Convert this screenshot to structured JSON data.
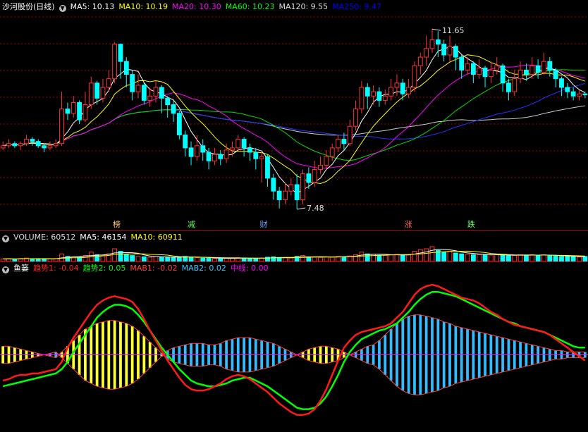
{
  "main_header": {
    "stock_name": "沙河股份(日线)",
    "items": [
      {
        "label": "MA5: 10.13",
        "color": "#ffffff"
      },
      {
        "label": "MA10: 10.19",
        "color": "#ffff00"
      },
      {
        "label": "MA20: 10.30",
        "color": "#ff00ff"
      },
      {
        "label": "MA60: 10.23",
        "color": "#00ff00"
      },
      {
        "label": "MA120: 9.55",
        "color": "#dddddd"
      },
      {
        "label": "MA250: 9.47",
        "color": "#0000ff"
      }
    ]
  },
  "price_high_label": "11.65",
  "price_low_label": "7.48",
  "event_markers": [
    {
      "text": "榜",
      "color": "#ffcc66",
      "pos": 0.199
    },
    {
      "text": "减",
      "color": "#66ff66",
      "pos": 0.326
    },
    {
      "text": "财",
      "color": "#66aaff",
      "pos": 0.449
    },
    {
      "text": "涨",
      "color": "#ff6666",
      "pos": 0.695
    },
    {
      "text": "跌",
      "color": "#66ff66",
      "pos": 0.802
    }
  ],
  "volume_header": {
    "items": [
      {
        "label": "VOLUME: 60512",
        "color": "#dddddd"
      },
      {
        "label": "MA5: 46154",
        "color": "#ffffff"
      },
      {
        "label": "MA10: 60911",
        "color": "#ffff00"
      }
    ]
  },
  "indicator_header": {
    "name": "鱼篓",
    "items": [
      {
        "label": "趋势1: -0.04",
        "color": "#ff2020"
      },
      {
        "label": "趋势2: 0.05",
        "color": "#00ff00"
      },
      {
        "label": "MAB1: -0.02",
        "color": "#ff4040"
      },
      {
        "label": "MAB2: 0.02",
        "color": "#33ccff"
      },
      {
        "label": "中线: 0.00",
        "color": "#ff00ff"
      }
    ]
  },
  "colors": {
    "up": "#ff3333",
    "down": "#00ffff",
    "grid": "#a00000",
    "yellow_bar": "#ffff33",
    "blue_bar": "#33bbff"
  },
  "chart_data": {
    "type": "candlestick",
    "price_range": [
      7.3,
      11.8
    ],
    "candles": [
      [
        8.9,
        8.95,
        9.05,
        8.85
      ],
      [
        8.95,
        9.0,
        9.1,
        8.9
      ],
      [
        9.0,
        8.95,
        9.05,
        8.9
      ],
      [
        8.95,
        9.0,
        9.05,
        8.85
      ],
      [
        9.0,
        9.1,
        9.2,
        8.95
      ],
      [
        9.1,
        9.05,
        9.15,
        8.95
      ],
      [
        9.05,
        8.95,
        9.1,
        8.9
      ],
      [
        8.95,
        8.9,
        9.0,
        8.8
      ],
      [
        8.9,
        8.95,
        9.05,
        8.85
      ],
      [
        8.95,
        9.0,
        9.1,
        8.9
      ],
      [
        9.0,
        9.8,
        10.2,
        8.95
      ],
      [
        9.8,
        9.7,
        9.95,
        9.55
      ],
      [
        9.7,
        9.95,
        10.1,
        9.6
      ],
      [
        9.95,
        9.55,
        10.0,
        9.45
      ],
      [
        9.55,
        9.9,
        10.2,
        9.5
      ],
      [
        9.9,
        10.4,
        10.55,
        9.8
      ],
      [
        10.4,
        10.05,
        10.45,
        9.9
      ],
      [
        10.05,
        10.3,
        10.5,
        9.95
      ],
      [
        10.3,
        10.5,
        10.7,
        10.2
      ],
      [
        10.5,
        11.3,
        11.35,
        10.4
      ],
      [
        11.3,
        10.9,
        11.3,
        10.5
      ],
      [
        10.9,
        10.6,
        11.0,
        10.3
      ],
      [
        10.6,
        10.2,
        10.7,
        10.0
      ],
      [
        10.2,
        10.35,
        10.6,
        10.05
      ],
      [
        10.35,
        10.0,
        10.4,
        9.9
      ],
      [
        10.0,
        10.1,
        10.3,
        9.85
      ],
      [
        10.1,
        10.3,
        10.45,
        9.95
      ],
      [
        10.3,
        10.05,
        10.35,
        9.7
      ],
      [
        10.05,
        9.9,
        10.1,
        9.6
      ],
      [
        9.9,
        9.7,
        10.0,
        9.5
      ],
      [
        9.7,
        9.2,
        9.75,
        9.1
      ],
      [
        9.2,
        8.9,
        9.3,
        8.7
      ],
      [
        8.9,
        8.7,
        9.05,
        8.5
      ],
      [
        8.7,
        8.95,
        9.2,
        8.6
      ],
      [
        8.95,
        8.8,
        9.1,
        8.6
      ],
      [
        8.8,
        8.6,
        8.9,
        8.4
      ],
      [
        8.6,
        8.75,
        8.9,
        8.5
      ],
      [
        8.75,
        8.65,
        8.85,
        8.5
      ],
      [
        8.65,
        8.85,
        9.0,
        8.55
      ],
      [
        8.85,
        8.9,
        9.05,
        8.7
      ],
      [
        8.9,
        9.1,
        9.2,
        8.8
      ],
      [
        9.1,
        8.9,
        9.15,
        8.7
      ],
      [
        8.9,
        8.8,
        9.0,
        8.6
      ],
      [
        8.8,
        8.65,
        8.9,
        8.4
      ],
      [
        8.65,
        8.7,
        8.8,
        8.1
      ],
      [
        8.7,
        8.2,
        8.75,
        8.0
      ],
      [
        8.2,
        7.9,
        8.3,
        7.7
      ],
      [
        7.9,
        7.7,
        8.0,
        7.5
      ],
      [
        7.7,
        7.9,
        8.1,
        7.6
      ],
      [
        7.9,
        8.05,
        8.2,
        7.8
      ],
      [
        8.05,
        7.7,
        8.3,
        7.48
      ],
      [
        7.7,
        8.3,
        8.4,
        7.6
      ],
      [
        8.3,
        8.1,
        8.45,
        7.95
      ],
      [
        8.1,
        8.4,
        8.6,
        8.0
      ],
      [
        8.4,
        8.5,
        8.7,
        8.3
      ],
      [
        8.5,
        8.7,
        8.85,
        8.4
      ],
      [
        8.7,
        8.9,
        9.0,
        8.6
      ],
      [
        8.9,
        9.1,
        9.2,
        8.8
      ],
      [
        9.1,
        9.0,
        9.25,
        8.85
      ],
      [
        9.0,
        9.4,
        9.55,
        8.95
      ],
      [
        9.4,
        9.8,
        10.0,
        9.3
      ],
      [
        9.8,
        10.3,
        10.45,
        9.7
      ],
      [
        10.3,
        10.1,
        10.4,
        9.8
      ],
      [
        10.1,
        10.2,
        10.35,
        9.9
      ],
      [
        10.2,
        10.0,
        10.3,
        9.85
      ],
      [
        10.0,
        10.1,
        10.25,
        9.9
      ],
      [
        10.1,
        10.3,
        10.5,
        10.0
      ],
      [
        10.3,
        10.4,
        10.6,
        10.1
      ],
      [
        10.4,
        10.15,
        10.5,
        10.0
      ],
      [
        10.15,
        10.3,
        10.5,
        10.05
      ],
      [
        10.3,
        10.8,
        10.9,
        10.2
      ],
      [
        10.8,
        11.0,
        11.1,
        10.6
      ],
      [
        11.0,
        11.2,
        11.5,
        10.8
      ],
      [
        11.2,
        11.4,
        11.65,
        11.1
      ],
      [
        11.4,
        11.3,
        11.6,
        11.0
      ],
      [
        11.3,
        11.05,
        11.4,
        10.9
      ],
      [
        11.05,
        11.25,
        11.5,
        10.9
      ],
      [
        11.25,
        11.0,
        11.3,
        10.7
      ],
      [
        11.0,
        10.7,
        11.05,
        10.5
      ],
      [
        10.7,
        10.85,
        11.0,
        10.6
      ],
      [
        10.85,
        10.6,
        10.9,
        10.4
      ],
      [
        10.6,
        10.75,
        10.95,
        10.5
      ],
      [
        10.75,
        10.55,
        10.8,
        10.3
      ],
      [
        10.55,
        10.7,
        10.9,
        10.4
      ],
      [
        10.7,
        10.8,
        11.0,
        10.6
      ],
      [
        10.8,
        10.4,
        10.85,
        10.2
      ],
      [
        10.4,
        10.2,
        10.5,
        10.0
      ],
      [
        10.2,
        10.5,
        10.7,
        10.1
      ],
      [
        10.5,
        10.7,
        10.9,
        10.4
      ],
      [
        10.7,
        10.6,
        10.85,
        10.45
      ],
      [
        10.6,
        10.8,
        11.0,
        10.5
      ],
      [
        10.8,
        10.65,
        10.95,
        10.5
      ],
      [
        10.65,
        10.9,
        11.1,
        10.6
      ],
      [
        10.9,
        10.7,
        11.0,
        10.55
      ],
      [
        10.7,
        10.5,
        10.75,
        10.3
      ],
      [
        10.5,
        10.3,
        10.55,
        10.1
      ],
      [
        10.3,
        10.2,
        10.4,
        10.05
      ],
      [
        10.2,
        10.1,
        10.3,
        10.0
      ],
      [
        10.1,
        10.15,
        10.25,
        10.0
      ],
      [
        10.15,
        10.13,
        10.2,
        10.05
      ]
    ],
    "volume_range": [
      0,
      200000
    ],
    "volumes": [
      30,
      32,
      28,
      35,
      40,
      33,
      30,
      28,
      31,
      34,
      90,
      60,
      55,
      50,
      70,
      110,
      80,
      75,
      90,
      150,
      120,
      85,
      70,
      60,
      55,
      50,
      58,
      52,
      48,
      45,
      55,
      60,
      50,
      45,
      40,
      38,
      36,
      35,
      37,
      40,
      45,
      42,
      38,
      35,
      40,
      50,
      55,
      48,
      45,
      42,
      60,
      70,
      55,
      50,
      48,
      52,
      55,
      60,
      58,
      65,
      80,
      110,
      90,
      85,
      70,
      72,
      80,
      85,
      78,
      75,
      120,
      140,
      150,
      175,
      130,
      110,
      120,
      100,
      90,
      85,
      80,
      82,
      78,
      75,
      80,
      75,
      70,
      72,
      78,
      74,
      80,
      72,
      78,
      70,
      65,
      60,
      58,
      55,
      52,
      60
    ],
    "indicator_range": [
      -0.5,
      0.5
    ],
    "trend1": [
      -0.18,
      -0.17,
      -0.15,
      -0.14,
      -0.14,
      -0.13,
      -0.13,
      -0.12,
      -0.11,
      -0.1,
      -0.05,
      0.05,
      0.12,
      0.18,
      0.24,
      0.3,
      0.35,
      0.38,
      0.4,
      0.41,
      0.4,
      0.39,
      0.37,
      0.32,
      0.25,
      0.17,
      0.1,
      0.03,
      -0.04,
      -0.1,
      -0.16,
      -0.21,
      -0.24,
      -0.25,
      -0.25,
      -0.24,
      -0.22,
      -0.2,
      -0.17,
      -0.15,
      -0.14,
      -0.15,
      -0.17,
      -0.2,
      -0.23,
      -0.26,
      -0.3,
      -0.34,
      -0.37,
      -0.4,
      -0.42,
      -0.42,
      -0.41,
      -0.38,
      -0.32,
      -0.24,
      -0.14,
      -0.04,
      0.05,
      0.1,
      0.14,
      0.16,
      0.17,
      0.18,
      0.19,
      0.2,
      0.22,
      0.26,
      0.3,
      0.36,
      0.42,
      0.46,
      0.48,
      0.49,
      0.48,
      0.46,
      0.44,
      0.42,
      0.4,
      0.39,
      0.38,
      0.36,
      0.33,
      0.3,
      0.28,
      0.25,
      0.23,
      0.21,
      0.2,
      0.19,
      0.18,
      0.17,
      0.16,
      0.14,
      0.11,
      0.08,
      0.05,
      0.02,
      -0.01,
      -0.04
    ],
    "trend2": [
      -0.22,
      -0.21,
      -0.2,
      -0.19,
      -0.18,
      -0.17,
      -0.16,
      -0.15,
      -0.14,
      -0.13,
      -0.1,
      -0.05,
      0.02,
      0.08,
      0.14,
      0.2,
      0.26,
      0.3,
      0.33,
      0.35,
      0.35,
      0.34,
      0.32,
      0.28,
      0.23,
      0.17,
      0.11,
      0.05,
      0.0,
      -0.05,
      -0.1,
      -0.14,
      -0.18,
      -0.2,
      -0.21,
      -0.22,
      -0.22,
      -0.21,
      -0.2,
      -0.18,
      -0.17,
      -0.16,
      -0.16,
      -0.18,
      -0.2,
      -0.22,
      -0.25,
      -0.28,
      -0.31,
      -0.34,
      -0.37,
      -0.38,
      -0.38,
      -0.37,
      -0.34,
      -0.29,
      -0.22,
      -0.14,
      -0.05,
      0.02,
      0.07,
      0.11,
      0.13,
      0.15,
      0.17,
      0.18,
      0.2,
      0.22,
      0.26,
      0.3,
      0.35,
      0.39,
      0.42,
      0.44,
      0.44,
      0.43,
      0.42,
      0.41,
      0.39,
      0.37,
      0.35,
      0.33,
      0.31,
      0.29,
      0.27,
      0.25,
      0.23,
      0.22,
      0.2,
      0.19,
      0.18,
      0.17,
      0.16,
      0.14,
      0.12,
      0.1,
      0.08,
      0.06,
      0.05,
      0.05
    ],
    "mab": [
      0.06,
      0.06,
      0.05,
      0.04,
      0.03,
      0.02,
      0.01,
      0.0,
      -0.01,
      -0.02,
      0.02,
      0.06,
      0.1,
      0.14,
      0.18,
      0.2,
      0.22,
      0.23,
      0.24,
      0.24,
      0.23,
      0.22,
      0.2,
      0.17,
      0.13,
      0.09,
      0.05,
      0.01,
      -0.03,
      -0.05,
      -0.06,
      -0.07,
      -0.08,
      -0.08,
      -0.08,
      -0.07,
      -0.07,
      -0.08,
      -0.1,
      -0.11,
      -0.12,
      -0.12,
      -0.12,
      -0.11,
      -0.1,
      -0.09,
      -0.08,
      -0.06,
      -0.04,
      -0.02,
      0.0,
      0.02,
      0.04,
      0.05,
      0.06,
      0.06,
      0.05,
      0.04,
      0.02,
      0.0,
      -0.02,
      -0.04,
      -0.06,
      -0.07,
      -0.1,
      -0.14,
      -0.18,
      -0.22,
      -0.25,
      -0.27,
      -0.28,
      -0.28,
      -0.27,
      -0.26,
      -0.25,
      -0.23,
      -0.22,
      -0.2,
      -0.19,
      -0.18,
      -0.17,
      -0.16,
      -0.15,
      -0.14,
      -0.13,
      -0.12,
      -0.11,
      -0.1,
      -0.09,
      -0.08,
      -0.07,
      -0.06,
      -0.05,
      -0.04,
      -0.03,
      -0.03,
      -0.02,
      -0.02,
      -0.02,
      -0.02
    ]
  }
}
